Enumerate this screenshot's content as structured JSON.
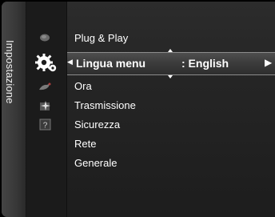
{
  "sidebar": {
    "title": "Impostazione"
  },
  "menu": {
    "items_above": [
      {
        "label": "Plug & Play"
      }
    ],
    "selected": {
      "label": "Lingua menu",
      "value": ": English"
    },
    "items_below": [
      {
        "label": "Ora"
      },
      {
        "label": "Trasmissione"
      },
      {
        "label": "Sicurezza"
      },
      {
        "label": "Rete"
      },
      {
        "label": "Generale"
      }
    ]
  },
  "icons": [
    "picture-icon",
    "setup-gear-icon",
    "application-icon",
    "support-icon",
    "help-icon"
  ],
  "colors": {
    "background": "#000000",
    "panel": "#262626",
    "highlight": "#3c3c3c",
    "text": "#ffffff"
  }
}
